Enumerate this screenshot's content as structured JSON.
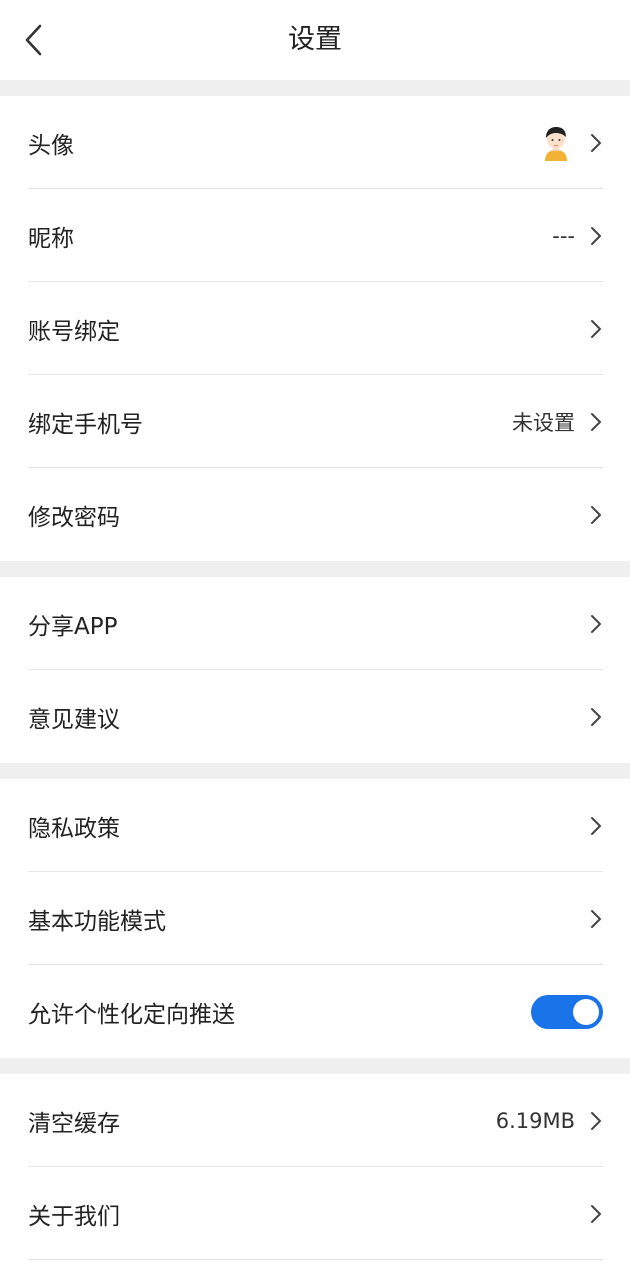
{
  "header": {
    "title": "设置"
  },
  "groups": {
    "account": {
      "avatar_label": "头像",
      "nickname_label": "昵称",
      "nickname_value": "---",
      "binding_label": "账号绑定",
      "phone_label": "绑定手机号",
      "phone_value": "未设置",
      "password_label": "修改密码"
    },
    "share": {
      "share_label": "分享APP",
      "feedback_label": "意见建议"
    },
    "privacy": {
      "policy_label": "隐私政策",
      "basic_mode_label": "基本功能模式",
      "personalized_label": "允许个性化定向推送",
      "personalized_enabled": true
    },
    "misc": {
      "cache_label": "清空缓存",
      "cache_value": "6.19MB",
      "about_label": "关于我们"
    }
  },
  "colors": {
    "accent": "#1a73e8",
    "separator": "#efefef",
    "divider": "#e6e6e6"
  },
  "icons": {
    "back": "chevron-left-icon",
    "row_arrow": "chevron-right-icon",
    "avatar": "avatar-icon"
  }
}
